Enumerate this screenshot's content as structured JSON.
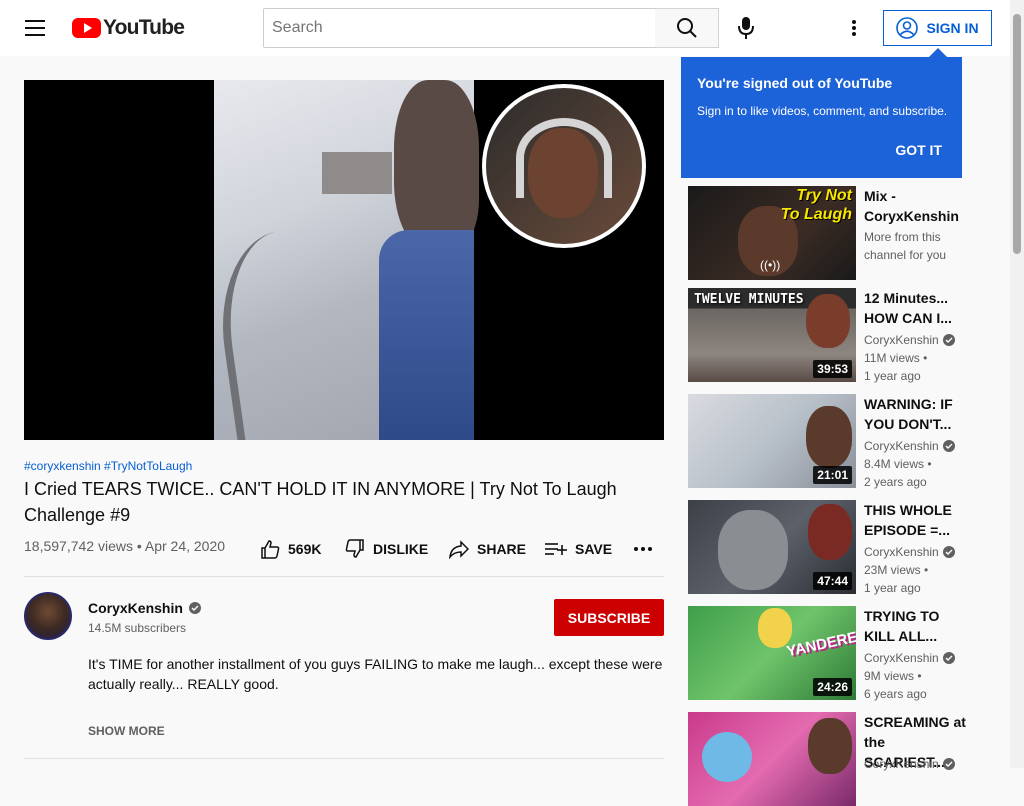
{
  "header": {
    "logo_text": "YouTube",
    "search_placeholder": "Search",
    "sign_in_label": "SIGN IN"
  },
  "popup": {
    "title": "You're signed out of YouTube",
    "text": "Sign in to like videos, comment, and subscribe.",
    "button": "GOT IT"
  },
  "video": {
    "hashtags": "#coryxkenshin #TryNotToLaugh",
    "title": "I Cried TEARS TWICE.. CAN'T HOLD IT IN ANYMORE | Try Not To Laugh Challenge #9",
    "views_date": "18,597,742 views • Apr 24, 2020",
    "likes": "569K",
    "dislike_label": "DISLIKE",
    "share_label": "SHARE",
    "save_label": "SAVE"
  },
  "channel": {
    "name": "CoryxKenshin",
    "subscribers": "14.5M subscribers",
    "subscribe_label": "SUBSCRIBE",
    "description": "It's TIME for another installment of you guys FAILING to make me laugh... except these were actually really... REALLY good.",
    "show_more": "SHOW MORE"
  },
  "recommendations": [
    {
      "title": "Mix - CoryxKenshin",
      "line2": "More from this",
      "line3": "channel for you",
      "thumb_text_1": "Try Not",
      "thumb_text_2": "To Laugh",
      "live_icon": "((•))"
    },
    {
      "title": "12 Minutes... HOW CAN I...",
      "channel": "CoryxKenshin",
      "views": "11M views •",
      "age": "1 year ago",
      "duration": "39:53",
      "thumb_text": "TWELVE MINUTES"
    },
    {
      "title": "WARNING: IF YOU DON'T...",
      "channel": "CoryxKenshin",
      "views": "8.4M views •",
      "age": "2 years ago",
      "duration": "21:01"
    },
    {
      "title": "THIS WHOLE EPISODE =...",
      "channel": "CoryxKenshin",
      "views": "23M views •",
      "age": "1 year ago",
      "duration": "47:44"
    },
    {
      "title": "TRYING TO KILL ALL...",
      "channel": "CoryxKenshin",
      "views": "9M views •",
      "age": "6 years ago",
      "duration": "24:26",
      "thumb_text": "YANDERE"
    },
    {
      "title": "SCREAMING at the SCARIEST...",
      "channel": "CoryxKenshin"
    }
  ],
  "colors": {
    "brand_red": "#ff0000",
    "subscribe_red": "#cc0000",
    "link_blue": "#065fd4",
    "popup_blue": "#1c62d8"
  },
  "icons": [
    "menu-icon",
    "youtube-logo-icon",
    "search-icon",
    "mic-icon",
    "more-vert-icon",
    "account-icon",
    "thumb-up-icon",
    "thumb-down-icon",
    "share-icon",
    "save-playlist-icon",
    "more-horiz-icon",
    "verified-icon"
  ]
}
